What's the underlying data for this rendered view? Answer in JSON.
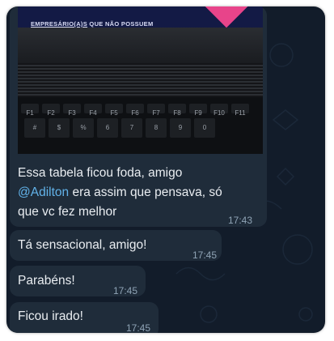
{
  "photo": {
    "banner_prefix": "EMPRESÁRIO(A)S",
    "banner_rest": " QUE NÃO POSSUEM"
  },
  "messages": [
    {
      "line1": "Essa tabela ficou foda, amigo",
      "mention": "@Adilton",
      "line2_rest": " era assim que pensava, só",
      "line3": "que vc fez melhor",
      "time": "17:43"
    },
    {
      "text": "Tá sensacional, amigo!",
      "time": "17:45"
    },
    {
      "text": "Parabéns!",
      "time": "17:45"
    },
    {
      "text": "Ficou irado!",
      "time": "17:45"
    }
  ],
  "keys": {
    "row1": [
      "F1",
      "F2",
      "F3",
      "F4",
      "F5",
      "F6",
      "F7",
      "F8",
      "F9",
      "F10",
      "F11"
    ],
    "row2": [
      "#",
      "$",
      "%",
      "6",
      "7",
      "8",
      "9",
      "0"
    ]
  }
}
